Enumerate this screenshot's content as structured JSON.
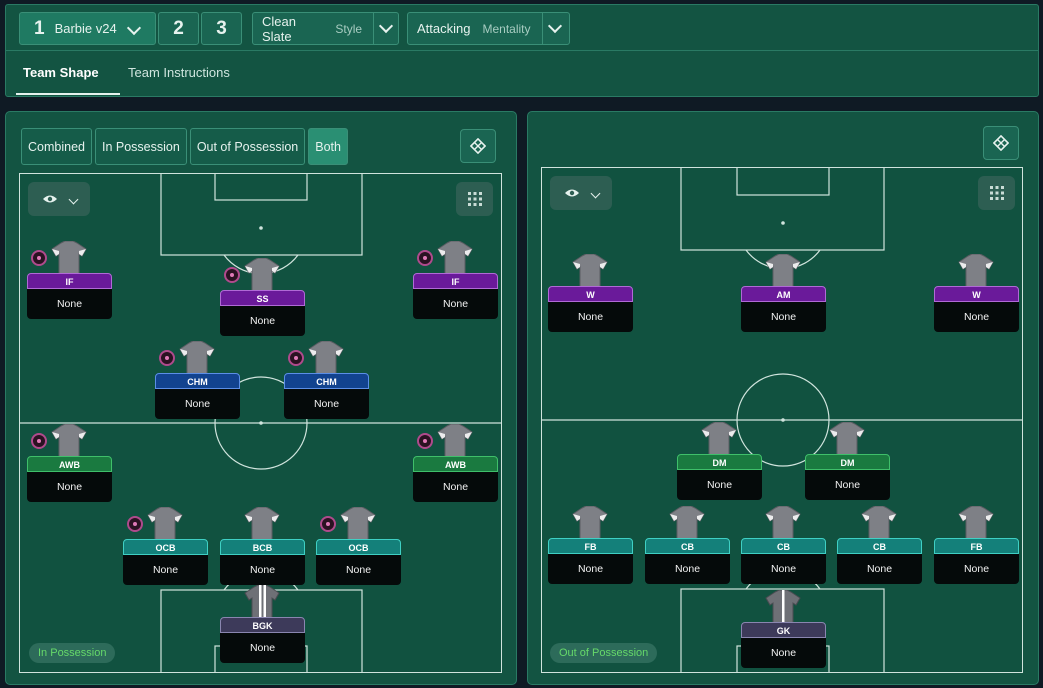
{
  "tactic": {
    "number": "1",
    "name": "Barbie v24",
    "slots": [
      "2",
      "3"
    ]
  },
  "style": {
    "label": "Clean Slate",
    "value": "Style"
  },
  "mentality": {
    "label": "Attacking",
    "value": "Mentality"
  },
  "tabs": [
    {
      "label": "Team Shape"
    },
    {
      "label": "Team Instructions"
    }
  ],
  "phase_buttons": [
    "Combined",
    "In Possession",
    "Out of Possession",
    "Both"
  ],
  "left_panel": {
    "phase_label": "In Possession",
    "players": [
      {
        "role": "IF",
        "info": "None"
      },
      {
        "role": "SS",
        "info": "None"
      },
      {
        "role": "IF",
        "info": "None"
      },
      {
        "role": "CHM",
        "info": "None"
      },
      {
        "role": "CHM",
        "info": "None"
      },
      {
        "role": "AWB",
        "info": "None"
      },
      {
        "role": "AWB",
        "info": "None"
      },
      {
        "role": "OCB",
        "info": "None"
      },
      {
        "role": "BCB",
        "info": "None"
      },
      {
        "role": "OCB",
        "info": "None"
      },
      {
        "role": "BGK",
        "info": "None"
      }
    ]
  },
  "right_panel": {
    "phase_label": "Out of Possession",
    "players": [
      {
        "role": "W",
        "info": "None"
      },
      {
        "role": "AM",
        "info": "None"
      },
      {
        "role": "W",
        "info": "None"
      },
      {
        "role": "DM",
        "info": "None"
      },
      {
        "role": "DM",
        "info": "None"
      },
      {
        "role": "FB",
        "info": "None"
      },
      {
        "role": "CB",
        "info": "None"
      },
      {
        "role": "CB",
        "info": "None"
      },
      {
        "role": "CB",
        "info": "None"
      },
      {
        "role": "FB",
        "info": "None"
      },
      {
        "role": "GK",
        "info": "None"
      }
    ]
  },
  "colors": {
    "panel": "#135442",
    "pitch": "#115240",
    "attack_role": "#6a1a9a",
    "midfield_role": "#12438f",
    "wingback_role": "#1a7a40",
    "defence_role": "#14807a",
    "keeper_role": "#3d3a5a",
    "phase_text": "#66d96a"
  },
  "icons": {
    "view": "eye-icon",
    "dropdown": "chevron-down-icon",
    "formation_grid": "formation-grid-icon",
    "tactics_board": "tactics-board-icon",
    "player_shirt": "shirt-icon",
    "trait": "trait-icon",
    "keeper_shirt": "keeper-shirt-icon"
  }
}
